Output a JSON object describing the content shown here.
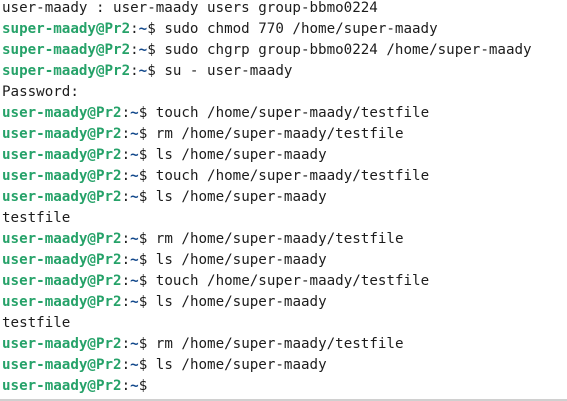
{
  "terminal": {
    "lines": [
      {
        "kind": "output",
        "text": "user-maady : user-maady users group-bbmo0224"
      },
      {
        "kind": "prompt",
        "user_host": "super-maady@Pr2",
        "sep": ":",
        "cwd": "~",
        "mark": "$ ",
        "cmd": "sudo chmod 770 /home/super-maady"
      },
      {
        "kind": "prompt",
        "user_host": "super-maady@Pr2",
        "sep": ":",
        "cwd": "~",
        "mark": "$ ",
        "cmd": "sudo chgrp group-bbmo0224 /home/super-maady"
      },
      {
        "kind": "prompt",
        "user_host": "super-maady@Pr2",
        "sep": ":",
        "cwd": "~",
        "mark": "$ ",
        "cmd": "su - user-maady"
      },
      {
        "kind": "output",
        "text": "Password:"
      },
      {
        "kind": "prompt",
        "user_host": "user-maady@Pr2",
        "sep": ":",
        "cwd": "~",
        "mark": "$ ",
        "cmd": "touch /home/super-maady/testfile"
      },
      {
        "kind": "prompt",
        "user_host": "user-maady@Pr2",
        "sep": ":",
        "cwd": "~",
        "mark": "$ ",
        "cmd": "rm /home/super-maady/testfile"
      },
      {
        "kind": "prompt",
        "user_host": "user-maady@Pr2",
        "sep": ":",
        "cwd": "~",
        "mark": "$ ",
        "cmd": "ls /home/super-maady"
      },
      {
        "kind": "prompt",
        "user_host": "user-maady@Pr2",
        "sep": ":",
        "cwd": "~",
        "mark": "$ ",
        "cmd": "touch /home/super-maady/testfile"
      },
      {
        "kind": "prompt",
        "user_host": "user-maady@Pr2",
        "sep": ":",
        "cwd": "~",
        "mark": "$ ",
        "cmd": "ls /home/super-maady"
      },
      {
        "kind": "output",
        "text": "testfile"
      },
      {
        "kind": "prompt",
        "user_host": "user-maady@Pr2",
        "sep": ":",
        "cwd": "~",
        "mark": "$ ",
        "cmd": "rm /home/super-maady/testfile"
      },
      {
        "kind": "prompt",
        "user_host": "user-maady@Pr2",
        "sep": ":",
        "cwd": "~",
        "mark": "$ ",
        "cmd": "ls /home/super-maady"
      },
      {
        "kind": "prompt",
        "user_host": "user-maady@Pr2",
        "sep": ":",
        "cwd": "~",
        "mark": "$ ",
        "cmd": "touch /home/super-maady/testfile"
      },
      {
        "kind": "prompt",
        "user_host": "user-maady@Pr2",
        "sep": ":",
        "cwd": "~",
        "mark": "$ ",
        "cmd": "ls /home/super-maady"
      },
      {
        "kind": "output",
        "text": "testfile"
      },
      {
        "kind": "prompt",
        "user_host": "user-maady@Pr2",
        "sep": ":",
        "cwd": "~",
        "mark": "$ ",
        "cmd": "rm /home/super-maady/testfile"
      },
      {
        "kind": "prompt",
        "user_host": "user-maady@Pr2",
        "sep": ":",
        "cwd": "~",
        "mark": "$ ",
        "cmd": "ls /home/super-maady"
      },
      {
        "kind": "prompt",
        "user_host": "user-maady@Pr2",
        "sep": ":",
        "cwd": "~",
        "mark": "$",
        "cmd": ""
      }
    ]
  },
  "colors": {
    "background": "#ffffff",
    "text": "#1c1c1c",
    "prompt_user_host": "#26a269",
    "prompt_cwd": "#12488b"
  }
}
